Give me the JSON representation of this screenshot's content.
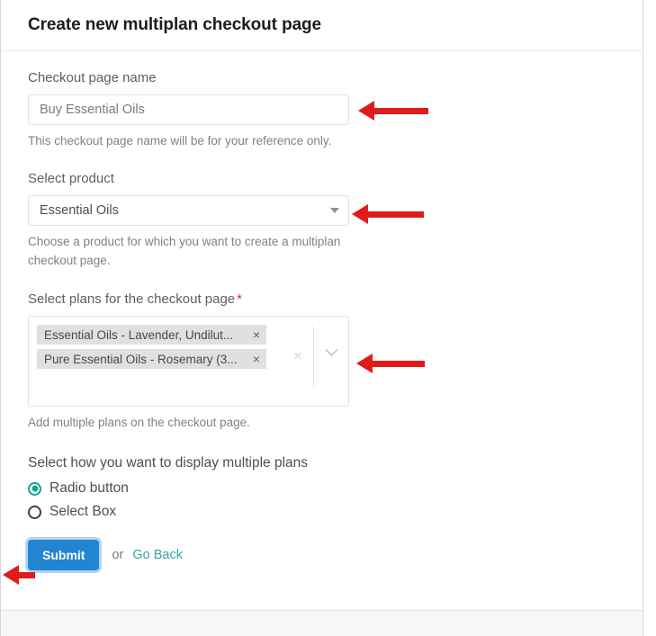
{
  "header": {
    "title": "Create new multiplan checkout page"
  },
  "form": {
    "name_field": {
      "label": "Checkout page name",
      "value": "Buy Essential Oils",
      "placeholder": "Checkout page name",
      "helper": "This checkout page name will be for your reference only."
    },
    "product_field": {
      "label": "Select product",
      "value": "Essential Oils",
      "helper": "Choose a product for which you want to create a multiplan checkout page."
    },
    "plans_field": {
      "label": "Select plans for the checkout page",
      "required_marker": "*",
      "tags": [
        {
          "label": "Essential Oils - Lavender, Undilut...",
          "remove": "×"
        },
        {
          "label": "Pure Essential Oils - Rosemary (3...",
          "remove": "×"
        }
      ],
      "clear_icon": "×",
      "helper": "Add multiple plans on the checkout page."
    },
    "display_field": {
      "label": "Select how you want to display multiple plans",
      "options": [
        {
          "label": "Radio button",
          "selected": true
        },
        {
          "label": "Select Box",
          "selected": false
        }
      ]
    }
  },
  "actions": {
    "submit_label": "Submit",
    "or_label": "or",
    "goback_label": "Go Back"
  },
  "colors": {
    "primary_button": "#2185d0",
    "link": "#39a4a0",
    "radio_selected": "#16a391",
    "required_star": "#db2828",
    "annotation_arrow": "#e01b1b"
  }
}
